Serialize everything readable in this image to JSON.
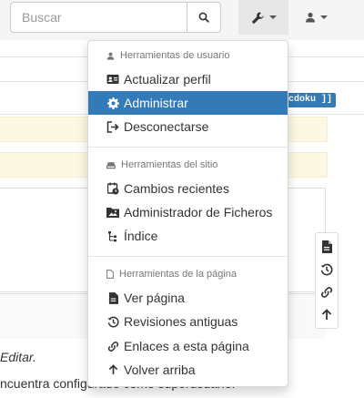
{
  "navbar": {
    "search_placeholder": "Buscar"
  },
  "colors": {
    "accent": "#337ab7",
    "alert_bg": "#fcf8e3"
  },
  "background": {
    "badge": "cdoku ]]",
    "text_line1": "Editar.",
    "text_line2": "ncuentra configurado como superusuario."
  },
  "dropdown": {
    "sections": [
      {
        "header": "Herramientas de usuario",
        "header_icon": "user-icon",
        "items": [
          {
            "label": "Actualizar perfil",
            "icon": "id-card-icon"
          },
          {
            "label": "Administrar",
            "icon": "gear-icon",
            "active": true
          },
          {
            "label": "Desconectarse",
            "icon": "sign-out-icon"
          }
        ]
      },
      {
        "header": "Herramientas del sitio",
        "header_icon": "hdd-icon",
        "items": [
          {
            "label": "Cambios recientes",
            "icon": "calendar-clock-icon"
          },
          {
            "label": "Administrador de Ficheros",
            "icon": "image-folder-icon"
          },
          {
            "label": "Índice",
            "icon": "sitemap-icon"
          }
        ]
      },
      {
        "header": "Herramientas de la página",
        "header_icon": "file-icon",
        "items": [
          {
            "label": "Ver página",
            "icon": "file-text-icon"
          },
          {
            "label": "Revisiones antiguas",
            "icon": "history-icon"
          },
          {
            "label": "Enlaces a esta página",
            "icon": "link-icon"
          },
          {
            "label": "Volver arriba",
            "icon": "arrow-up-icon"
          }
        ]
      }
    ]
  },
  "pagetools": [
    "file-text-icon",
    "history-icon",
    "link-icon",
    "arrow-up-icon"
  ]
}
